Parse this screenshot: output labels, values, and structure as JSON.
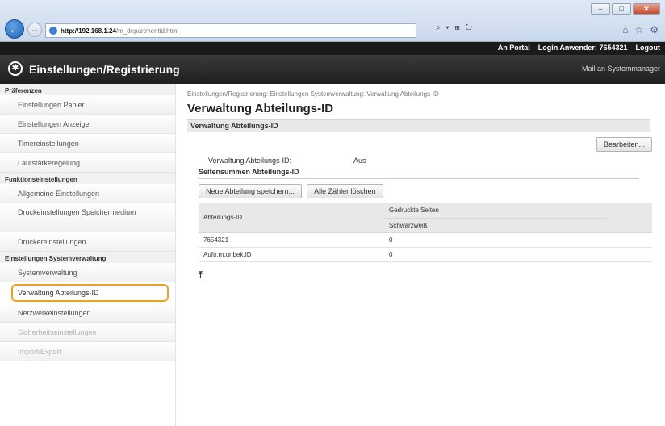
{
  "browser": {
    "url_host": "http://192.168.1.24",
    "url_path": "/m_departmentid.html",
    "address_tools": "⌕ ▾ ⊞ ↻",
    "icons": [
      "home-icon",
      "star-icon",
      "gear-icon"
    ],
    "window_controls": [
      "–",
      "□",
      "✕"
    ]
  },
  "topbar": {
    "portal": "An Portal",
    "login_label": "Login Anwender:",
    "login_id": "7654321",
    "logout": "Logout"
  },
  "header": {
    "title": "Einstellungen/Registrierung",
    "mail": "Mail an Systemmanager"
  },
  "sidebar": {
    "sections": [
      {
        "label": "Präferenzen",
        "items": [
          "Einstellungen Papier",
          "Einstellungen Anzeige",
          "Timereinstellungen",
          "Lautstärkeregelung"
        ]
      },
      {
        "label": "Funktionseinstellungen",
        "items": [
          "Allgemeine Einstellungen",
          "Druckeinstellungen Speichermedium",
          "Druckereinstellungen"
        ]
      },
      {
        "label": "Einstellungen Systemverwaltung",
        "items": [
          "Systemverwaltung",
          "Verwaltung Abteilungs-ID",
          "Netzwerkeinstellungen",
          "Sicherheitseinstellungen",
          "Import/Export"
        ]
      }
    ]
  },
  "main": {
    "breadcrumb": "Einstellungen/Registrierung: Einstellungen Systemverwaltung: Verwaltung Abteilungs-ID",
    "title": "Verwaltung Abteilungs-ID",
    "section_label": "Verwaltung Abteilungs-ID",
    "edit_button": "Bearbeiten...",
    "status_key": "Verwaltung Abteilungs-ID:",
    "status_value": "Aus",
    "subsection_label": "Seitensummen Abteilungs-ID",
    "buttons": [
      "Neue Abteilung speichern...",
      "Alle Zähler löschen"
    ],
    "table": {
      "col1": "Abteilungs-ID",
      "col2_top": "Gedruckte Seiten",
      "col2_sub": "Schwarzweiß",
      "rows": [
        {
          "id": "7654321",
          "count": "0"
        },
        {
          "id": "Auftr.m.unbek.ID",
          "count": "0"
        }
      ]
    },
    "top_link": "⤒"
  }
}
